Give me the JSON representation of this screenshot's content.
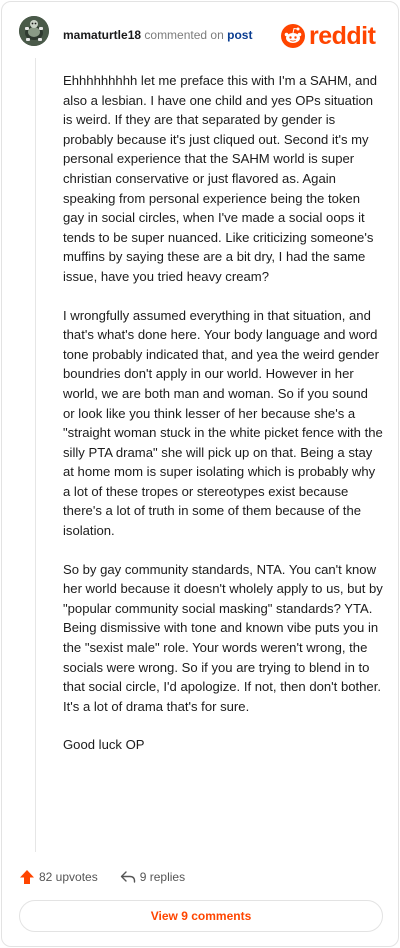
{
  "header": {
    "username": "mamaturtle18",
    "commented_on": "commented on",
    "post_link": "post",
    "brand": "reddit"
  },
  "comment": {
    "paragraphs": [
      "Ehhhhhhhhh let me preface this with I'm a SAHM, and also a lesbian. I have one child and yes OPs situation is weird. If they are that separated by gender is probably because it's just cliqued out. Second it's my personal experience that the SAHM world is super christian conservative or just flavored as. Again speaking from personal experience being the token gay in social circles, when I've made a social oops it tends to be super nuanced. Like criticizing someone's muffins by saying these are a bit dry, I had the same issue, have you tried heavy cream?",
      "I wrongfully assumed everything in that situation, and that's what's done here. Your body language and word tone probably indicated that, and yea the weird gender boundries don't apply in our world. However in her world, we are both man and woman. So if you sound or look like you think lesser of her because she's a \"straight woman stuck in the white picket fence with the silly PTA drama\" she will pick up on that. Being a stay at home mom is super isolating which is probably why a lot of these tropes or stereotypes exist because there's a lot of truth in some of them because of the isolation.",
      "So by gay community standards, NTA. You can't know her world because it doesn't wholely apply to us, but by \"popular community social masking\" standards? YTA. Being dismissive with tone and known vibe puts you in the \"sexist male\" role. Your words weren't wrong, the socials were wrong. So if you are trying to blend in to that social circle, I'd apologize. If not, then don't bother. It's a lot of drama that's for sure.",
      "Good luck OP"
    ]
  },
  "actions": {
    "upvotes": "82 upvotes",
    "replies": "9 replies",
    "view_comments": "View 9 comments"
  },
  "colors": {
    "accent": "#ff4500",
    "link": "#0a3d91",
    "muted": "#7c7c7c"
  },
  "icons": {
    "avatar": "turtle-avatar-icon",
    "brand": "reddit-logo-icon",
    "upvote": "upvote-arrow-icon",
    "reply": "reply-arrow-icon"
  }
}
